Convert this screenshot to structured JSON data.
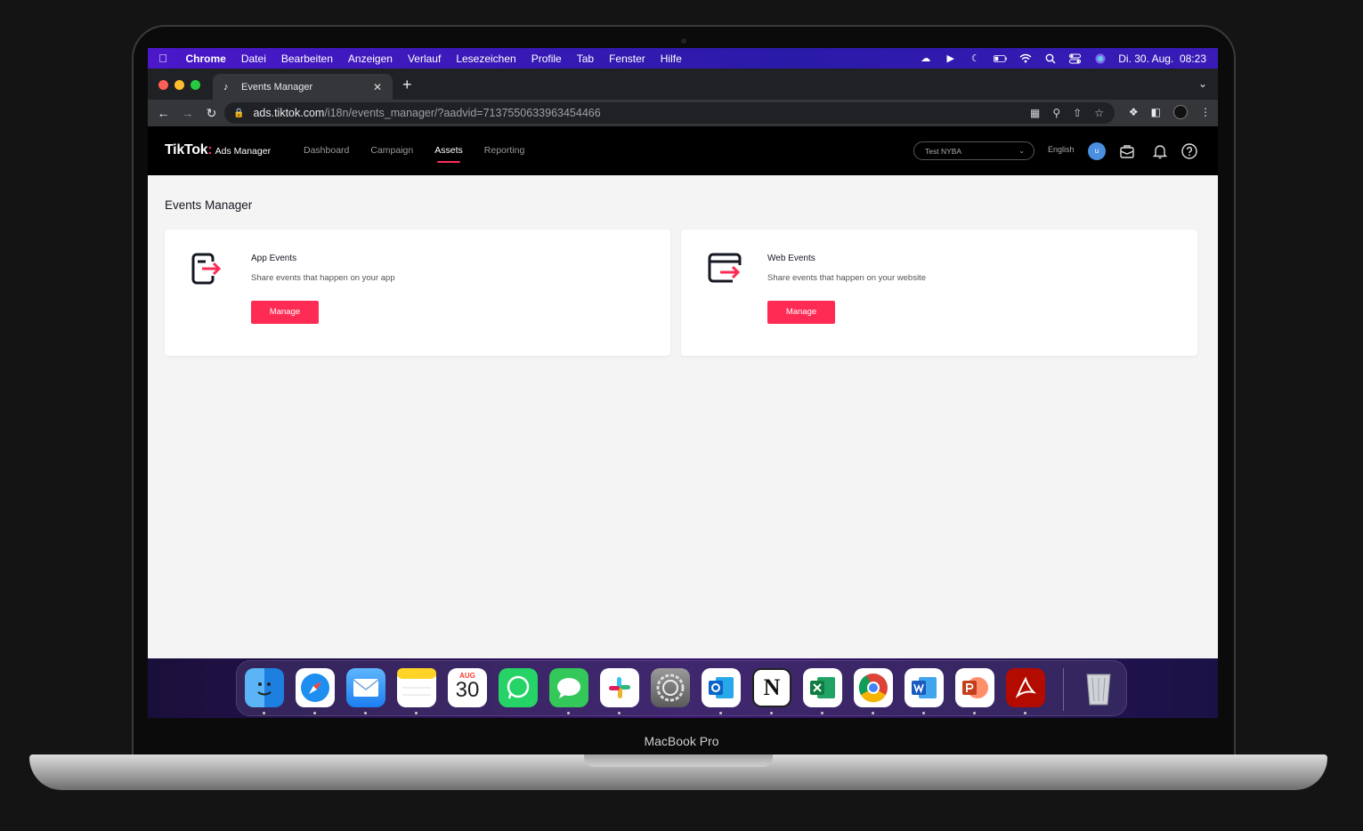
{
  "device": {
    "label": "MacBook Pro"
  },
  "menubar": {
    "items": [
      "Chrome",
      "Datei",
      "Bearbeiten",
      "Anzeigen",
      "Verlauf",
      "Lesezeichen",
      "Profile",
      "Tab",
      "Fenster",
      "Hilfe"
    ],
    "datetime": "Di. 30. Aug.  08:23"
  },
  "browser": {
    "tab_title": "Events Manager",
    "url_host": "ads.tiktok.com",
    "url_path": "/i18n/events_manager/?aadvid=7137550633963454466"
  },
  "header": {
    "logo_text": "TikTok",
    "logo_sub": "Ads Manager",
    "nav": [
      "Dashboard",
      "Campaign",
      "Assets",
      "Reporting"
    ],
    "active_nav": "Assets",
    "account": "Test NYBA",
    "language": "English",
    "avatar_initial": "u"
  },
  "page": {
    "title": "Events Manager",
    "cards": [
      {
        "title": "App Events",
        "description": "Share events that happen on your app",
        "button": "Manage"
      },
      {
        "title": "Web Events",
        "description": "Share events that happen on your website",
        "button": "Manage"
      }
    ]
  },
  "dock": {
    "calendar_month": "AUG",
    "calendar_day": "30"
  },
  "colors": {
    "accent": "#fe2c55",
    "header_bg": "#000000",
    "page_bg": "#f4f4f4"
  }
}
